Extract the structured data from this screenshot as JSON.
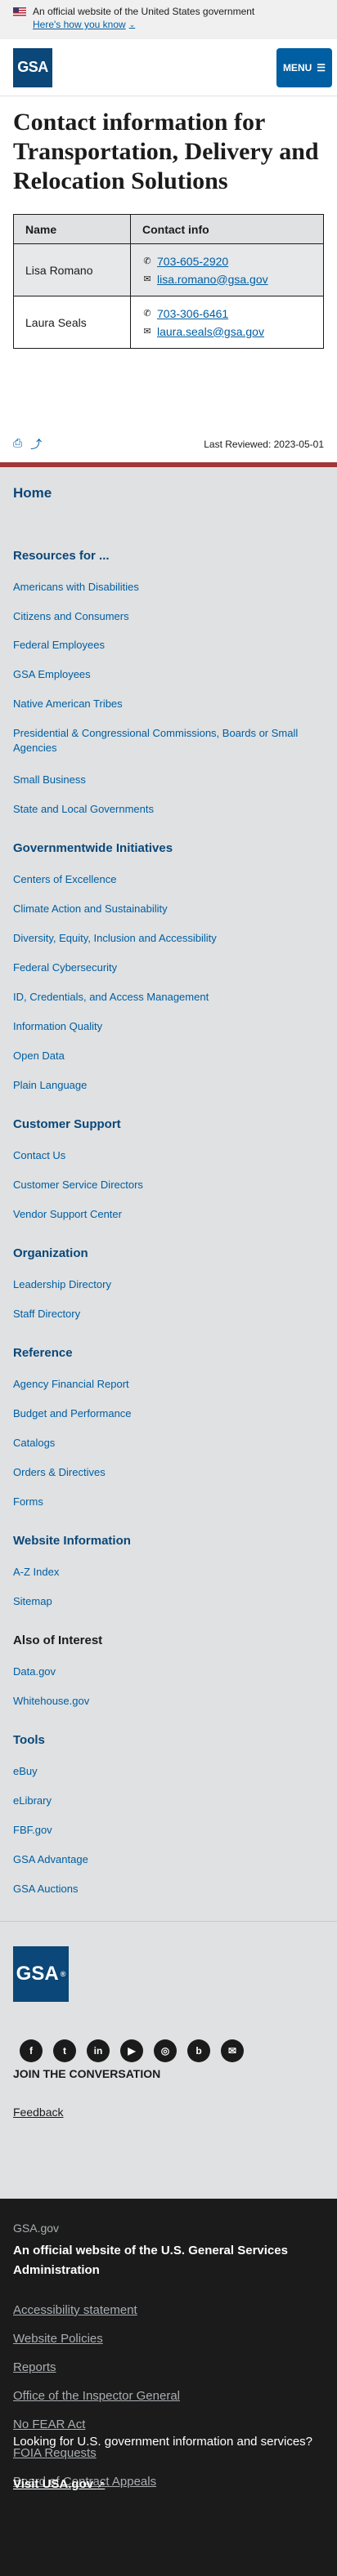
{
  "banner": {
    "text": "An official website of the United States government",
    "how_you_know": "Here's how you know"
  },
  "header": {
    "logo_text": "GSA",
    "menu_label": "MENU"
  },
  "page": {
    "title": "Contact information for Transportation, Delivery and Relocation Solutions",
    "table_headers": [
      "Name",
      "Contact info"
    ],
    "contacts": [
      {
        "name": "Lisa Romano",
        "phone": "703-605-2920",
        "email": "lisa.romano@gsa.gov"
      },
      {
        "name": "Laura Seals",
        "phone": "703-306-6461",
        "email": "laura.seals@gsa.gov"
      }
    ],
    "last_reviewed": "Last Reviewed: 2023-05-01"
  },
  "nav": {
    "home": "Home",
    "sections": [
      {
        "title": "Resources for ...",
        "links": [
          "Americans with Disabilities",
          "Citizens and Consumers",
          "Federal Employees",
          "GSA Employees",
          "Native American Tribes",
          "Presidential & Congressional Commissions, Boards or Small Agencies",
          "Small Business",
          "State and Local Governments"
        ]
      },
      {
        "title": "Governmentwide Initiatives",
        "links": [
          "Centers of Excellence",
          "Climate Action and Sustainability",
          "Diversity, Equity, Inclusion and Accessibility",
          "Federal Cybersecurity",
          "ID, Credentials, and Access Management",
          "Information Quality",
          "Open Data",
          "Plain Language"
        ]
      },
      {
        "title": "Customer Support",
        "links": [
          "Contact Us",
          "Customer Service Directors",
          "Vendor Support Center"
        ]
      },
      {
        "title": "Organization",
        "links": [
          "Leadership Directory",
          "Staff Directory"
        ]
      },
      {
        "title": "Reference",
        "links": [
          "Agency Financial Report",
          "Budget and Performance",
          "Catalogs",
          "Orders & Directives",
          "Forms"
        ]
      },
      {
        "title": "Website Information",
        "links": [
          "A-Z Index",
          "Sitemap"
        ]
      },
      {
        "title": "Also of Interest",
        "links": [
          "Data.gov",
          "Whitehouse.gov"
        ]
      },
      {
        "title": "Tools",
        "links": [
          "eBuy",
          "eLibrary",
          "FBF.gov",
          "GSA Advantage",
          "GSA Auctions"
        ]
      }
    ]
  },
  "footer": {
    "logo_text": "GSA",
    "join": "JOIN THE CONVERSATION",
    "feedback": "Feedback",
    "social_icons": [
      "facebook-icon",
      "twitter-icon",
      "linkedin-icon",
      "youtube-icon",
      "instagram-icon",
      "blog-icon",
      "email-icon"
    ],
    "site": "GSA.gov",
    "tagline": "An official website of the U.S. General Services Administration",
    "links": [
      "Accessibility statement",
      "Website Policies",
      "Reports",
      "Office of the Inspector General",
      "No FEAR Act",
      "FOIA Requests",
      "Board of Contract Appeals"
    ],
    "looking": "Looking for U.S. government information and services?",
    "visit": "Visit USA.gov"
  }
}
